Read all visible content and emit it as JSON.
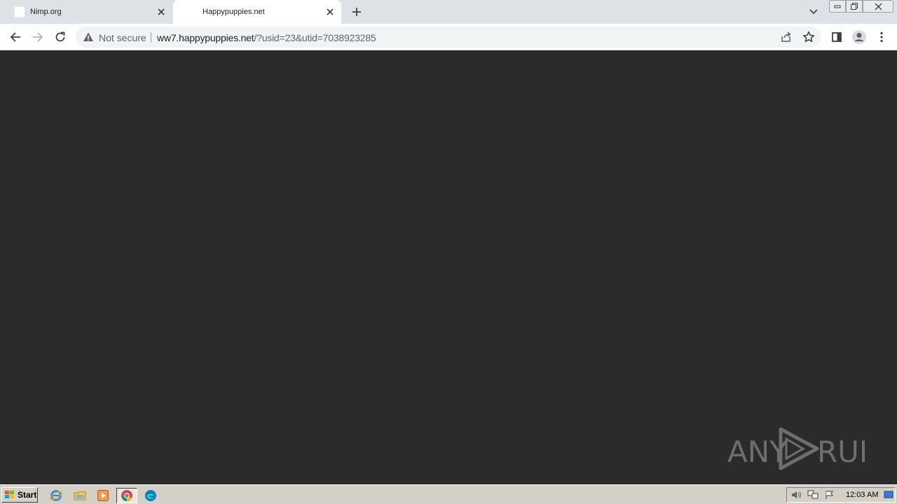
{
  "tabs": [
    {
      "title": "Nimp.org",
      "active": false
    },
    {
      "title": "Happypuppies.net",
      "active": true
    }
  ],
  "omnibox": {
    "security_label": "Not secure",
    "url_host": "ww7.happypuppies.net",
    "url_rest": "/?usid=23&utid=7038923285"
  },
  "watermark": {
    "text_left": "ANY",
    "text_right": "RUN"
  },
  "taskbar": {
    "start_label": "Start",
    "apps": [
      "internet-explorer-icon",
      "file-explorer-icon",
      "media-player-icon",
      "chrome-icon",
      "edge-icon"
    ],
    "clock": "12:03 AM"
  },
  "colors": {
    "content_bg": "#2b2b2b",
    "tabstrip_bg": "#dee1e6",
    "taskbar_bg": "#d4d0c8"
  }
}
